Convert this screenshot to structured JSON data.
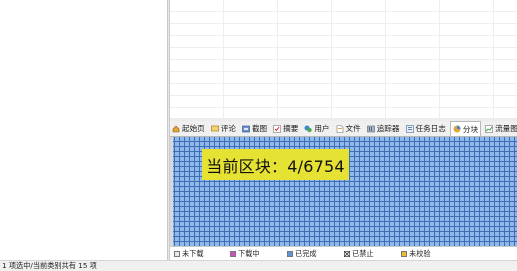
{
  "tabs": [
    {
      "label": "起始页",
      "icon": "home-icon"
    },
    {
      "label": "评论",
      "icon": "comment-icon"
    },
    {
      "label": "截图",
      "icon": "screenshot-icon"
    },
    {
      "label": "摘要",
      "icon": "summary-icon"
    },
    {
      "label": "用户",
      "icon": "user-icon"
    },
    {
      "label": "文件",
      "icon": "file-icon"
    },
    {
      "label": "追踪器",
      "icon": "tracker-icon"
    },
    {
      "label": "任务日志",
      "icon": "task-log-icon"
    },
    {
      "label": "分块",
      "icon": "blocks-icon"
    },
    {
      "label": "流量图",
      "icon": "traffic-chart-icon"
    }
  ],
  "active_tab": "分块",
  "current_block": "当前区块：4/6754",
  "legend": [
    {
      "label": "未下载",
      "color": "#e9e9e9"
    },
    {
      "label": "下载中",
      "color": "#d04fc4"
    },
    {
      "label": "已完成",
      "color": "#5f95d8"
    },
    {
      "label": "已禁止",
      "color": "#ffffff"
    },
    {
      "label": "未校验",
      "color": "#e8c12e"
    }
  ],
  "colors": {
    "block_fill": "#8fb9ea",
    "block_border": "#3f6db3",
    "highlight": "#e6e233"
  },
  "status_text": "1 项选中/当前类别共有 15 项"
}
